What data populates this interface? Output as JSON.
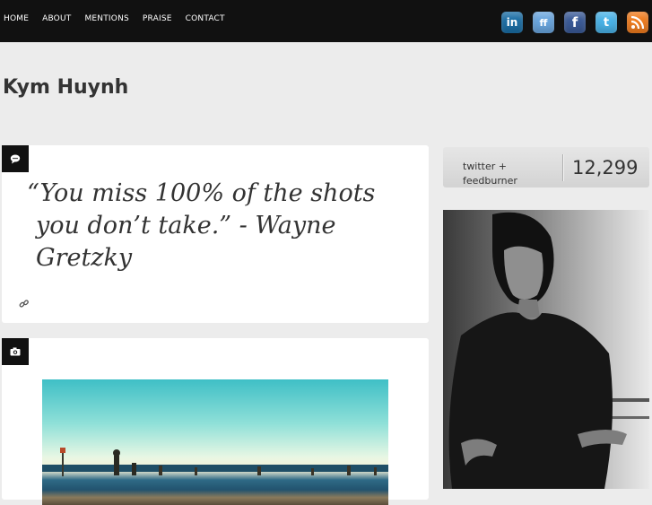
{
  "nav": {
    "items": [
      "HOME",
      "ABOUT",
      "MENTIONS",
      "PRAISE",
      "CONTACT"
    ]
  },
  "social": {
    "linkedin": "in",
    "friendfeed": "ff",
    "facebook": "f",
    "twitter": "t",
    "rss": "rss-icon"
  },
  "site": {
    "title": "Kym Huynh"
  },
  "posts": {
    "quote": {
      "text": "“You miss 100% of the shots you don’t take.” - Wayne Gretzky",
      "type_icon": "speech-bubble-icon"
    },
    "photo": {
      "type_icon": "camera-icon"
    }
  },
  "sidebar": {
    "counter_label": "twitter + feedburner",
    "counter_value": "12,299"
  },
  "colors": {
    "topbar": "#111111",
    "background": "#ececec",
    "card": "#ffffff",
    "text": "#333333"
  }
}
